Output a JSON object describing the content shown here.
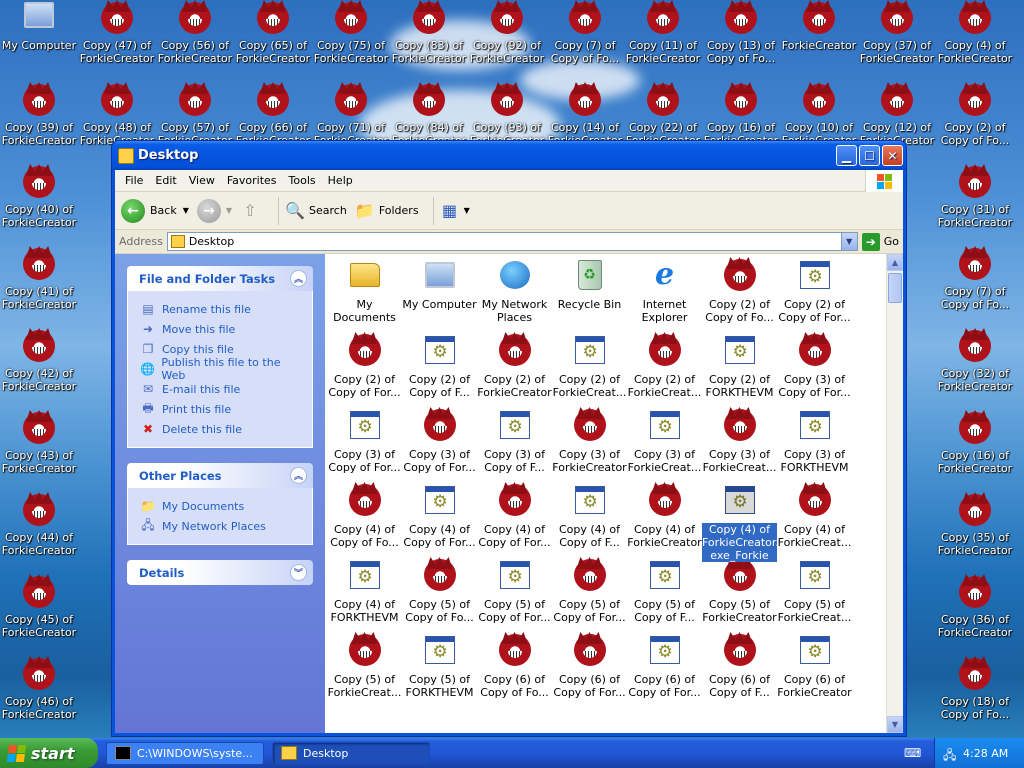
{
  "desktop": {
    "top_row": [
      {
        "l1": "My Computer",
        "l2": "",
        "kind": "computer"
      },
      {
        "l1": "Copy (47) of",
        "l2": "ForkieCreator",
        "kind": "forkie"
      },
      {
        "l1": "Copy (56) of",
        "l2": "ForkieCreator",
        "kind": "forkie"
      },
      {
        "l1": "Copy (65) of",
        "l2": "ForkieCreator",
        "kind": "forkie"
      },
      {
        "l1": "Copy (75) of",
        "l2": "ForkieCreator",
        "kind": "forkie"
      },
      {
        "l1": "Copy (83) of",
        "l2": "ForkieCreator",
        "kind": "forkie"
      },
      {
        "l1": "Copy (92) of",
        "l2": "ForkieCreator",
        "kind": "forkie"
      },
      {
        "l1": "Copy (7) of",
        "l2": "Copy of Fo...",
        "kind": "forkie"
      },
      {
        "l1": "Copy (11) of",
        "l2": "ForkieCreator",
        "kind": "forkie"
      },
      {
        "l1": "Copy (13) of",
        "l2": "Copy of Fo...",
        "kind": "forkie"
      },
      {
        "l1": "ForkieCreator",
        "l2": "",
        "kind": "forkie"
      },
      {
        "l1": "Copy (37) of",
        "l2": "ForkieCreator",
        "kind": "forkie"
      },
      {
        "l1": "Copy (4) of",
        "l2": "ForkieCreator",
        "kind": "forkie"
      }
    ],
    "second_row": [
      {
        "l1": "Copy (39) of",
        "l2": "ForkieCreator"
      },
      {
        "l1": "Copy (48) of",
        "l2": "ForkieCreator"
      },
      {
        "l1": "Copy (57) of",
        "l2": "ForkieCreator"
      },
      {
        "l1": "Copy (66) of",
        "l2": "ForkieCreator"
      },
      {
        "l1": "Copy (71) of",
        "l2": "ForkieCreator"
      },
      {
        "l1": "Copy (84) of",
        "l2": "ForkieCreator"
      },
      {
        "l1": "Copy (93) of",
        "l2": "ForkieCreator"
      },
      {
        "l1": "Copy (14) of",
        "l2": "ForkieCreator"
      },
      {
        "l1": "Copy (22) of",
        "l2": "ForkieCreator"
      },
      {
        "l1": "Copy (16) of",
        "l2": "ForkieCreator"
      },
      {
        "l1": "Copy (10) of",
        "l2": "ForkieCreator"
      },
      {
        "l1": "Copy (12) of",
        "l2": "ForkieCreator"
      },
      {
        "l1": "Copy (2) of",
        "l2": "Copy of Fo..."
      }
    ],
    "left_column": [
      {
        "l1": "Copy (40) of",
        "l2": "ForkieCreator"
      },
      {
        "l1": "Copy (41) of",
        "l2": "ForkieCreator"
      },
      {
        "l1": "Copy (42) of",
        "l2": "ForkieCreator"
      },
      {
        "l1": "Copy (43) of",
        "l2": "ForkieCreator"
      },
      {
        "l1": "Copy (44) of",
        "l2": "ForkieCreator"
      },
      {
        "l1": "Copy (45) of",
        "l2": "ForkieCreator"
      },
      {
        "l1": "Copy (46) of",
        "l2": "ForkieCreator"
      }
    ],
    "right_column": [
      {
        "l1": "Copy (31) of",
        "l2": "ForkieCreator"
      },
      {
        "l1": "Copy (7) of",
        "l2": "Copy of Fo..."
      },
      {
        "l1": "Copy (32) of",
        "l2": "ForkieCreator"
      },
      {
        "l1": "Copy (16) of",
        "l2": "ForkieCreator"
      },
      {
        "l1": "Copy (35) of",
        "l2": "ForkieCreator"
      },
      {
        "l1": "Copy (36) of",
        "l2": "ForkieCreator"
      },
      {
        "l1": "Copy (18) of",
        "l2": "Copy of Fo..."
      }
    ]
  },
  "window": {
    "title": "Desktop",
    "menu": [
      "File",
      "Edit",
      "View",
      "Favorites",
      "Tools",
      "Help"
    ],
    "toolbar": {
      "back": "Back",
      "search": "Search",
      "folders": "Folders"
    },
    "address": {
      "label": "Address",
      "value": "Desktop",
      "go": "Go"
    },
    "tasks": {
      "file_folder": {
        "title": "File and Folder Tasks",
        "items": [
          {
            "label": "Rename this file",
            "icon": "rename-icon"
          },
          {
            "label": "Move this file",
            "icon": "move-icon"
          },
          {
            "label": "Copy this file",
            "icon": "copy-icon"
          },
          {
            "label": "Publish this file to the Web",
            "icon": "publish-icon"
          },
          {
            "label": "E-mail this file",
            "icon": "email-icon"
          },
          {
            "label": "Print this file",
            "icon": "print-icon"
          },
          {
            "label": "Delete this file",
            "icon": "delete-icon"
          }
        ]
      },
      "other_places": {
        "title": "Other Places",
        "items": [
          {
            "label": "My Documents",
            "icon": "folder-icon"
          },
          {
            "label": "My Network Places",
            "icon": "network-icon"
          }
        ]
      },
      "details": {
        "title": "Details"
      }
    },
    "files": [
      {
        "l1": "My Documents",
        "l2": "",
        "kind": "folder"
      },
      {
        "l1": "My Computer",
        "l2": "",
        "kind": "computer"
      },
      {
        "l1": "My Network",
        "l2": "Places",
        "kind": "network"
      },
      {
        "l1": "Recycle Bin",
        "l2": "",
        "kind": "recycle"
      },
      {
        "l1": "Internet",
        "l2": "Explorer",
        "kind": "ie"
      },
      {
        "l1": "Copy (2) of",
        "l2": "Copy of Fo...",
        "kind": "forkie"
      },
      {
        "l1": "Copy (2) of",
        "l2": "Copy of For...",
        "kind": "exe"
      },
      {
        "l1": "Copy (2) of",
        "l2": "Copy of For...",
        "kind": "forkie"
      },
      {
        "l1": "Copy (2) of",
        "l2": "Copy of F...",
        "kind": "exe"
      },
      {
        "l1": "Copy (2) of",
        "l2": "ForkieCreator",
        "kind": "forkie"
      },
      {
        "l1": "Copy (2) of",
        "l2": "ForkieCreat...",
        "kind": "exe"
      },
      {
        "l1": "Copy (2) of",
        "l2": "ForkieCreat...",
        "kind": "forkie"
      },
      {
        "l1": "Copy (2) of",
        "l2": "FORKTHEVM",
        "kind": "exe"
      },
      {
        "l1": "Copy (3) of",
        "l2": "Copy of For...",
        "kind": "forkie"
      },
      {
        "l1": "Copy (3) of",
        "l2": "Copy of For...",
        "kind": "exe"
      },
      {
        "l1": "Copy (3) of",
        "l2": "Copy of For...",
        "kind": "forkie"
      },
      {
        "l1": "Copy (3) of",
        "l2": "Copy of F...",
        "kind": "exe"
      },
      {
        "l1": "Copy (3) of",
        "l2": "ForkieCreator",
        "kind": "forkie"
      },
      {
        "l1": "Copy (3) of",
        "l2": "ForkieCreat...",
        "kind": "exe"
      },
      {
        "l1": "Copy (3) of",
        "l2": "ForkieCreat...",
        "kind": "forkie"
      },
      {
        "l1": "Copy (3) of",
        "l2": "FORKTHEVM",
        "kind": "exe"
      },
      {
        "l1": "Copy (4) of",
        "l2": "Copy of Fo...",
        "kind": "forkie"
      },
      {
        "l1": "Copy (4) of",
        "l2": "Copy of For...",
        "kind": "exe"
      },
      {
        "l1": "Copy (4) of",
        "l2": "Copy of For...",
        "kind": "forkie"
      },
      {
        "l1": "Copy (4) of",
        "l2": "Copy of F...",
        "kind": "exe"
      },
      {
        "l1": "Copy (4) of",
        "l2": "ForkieCreator",
        "kind": "forkie"
      },
      {
        "l1": "Copy (4) of",
        "l2": "ForkieCreator.",
        "l3": "exe_Forkie",
        "kind": "exe",
        "selected": true
      },
      {
        "l1": "Copy (4) of",
        "l2": "ForkieCreat...",
        "kind": "forkie"
      },
      {
        "l1": "Copy (4) of",
        "l2": "FORKTHEVM",
        "kind": "exe"
      },
      {
        "l1": "Copy (5) of",
        "l2": "Copy of Fo...",
        "kind": "forkie"
      },
      {
        "l1": "Copy (5) of",
        "l2": "Copy of For...",
        "kind": "exe"
      },
      {
        "l1": "Copy (5) of",
        "l2": "Copy of For...",
        "kind": "forkie"
      },
      {
        "l1": "Copy (5) of",
        "l2": "Copy of F...",
        "kind": "exe"
      },
      {
        "l1": "Copy (5) of",
        "l2": "ForkieCreator",
        "kind": "forkie"
      },
      {
        "l1": "Copy (5) of",
        "l2": "ForkieCreat...",
        "kind": "exe"
      },
      {
        "l1": "Copy (5) of",
        "l2": "ForkieCreat...",
        "kind": "forkie"
      },
      {
        "l1": "Copy (5) of",
        "l2": "FORKTHEVM",
        "kind": "exe"
      },
      {
        "l1": "Copy (6) of",
        "l2": "Copy of Fo...",
        "kind": "forkie"
      },
      {
        "l1": "Copy (6) of",
        "l2": "Copy of For...",
        "kind": "forkie"
      },
      {
        "l1": "Copy (6) of",
        "l2": "Copy of For...",
        "kind": "exe"
      },
      {
        "l1": "Copy (6) of",
        "l2": "Copy of F...",
        "kind": "forkie"
      },
      {
        "l1": "Copy (6) of",
        "l2": "ForkieCreator",
        "kind": "exe"
      }
    ]
  },
  "taskbar": {
    "start": "start",
    "tasks": [
      {
        "label": "C:\\WINDOWS\\syste...",
        "icon": "cmd-icon",
        "active": false
      },
      {
        "label": "Desktop",
        "icon": "folder-icon",
        "active": true
      }
    ],
    "clock": "4:28 AM"
  }
}
